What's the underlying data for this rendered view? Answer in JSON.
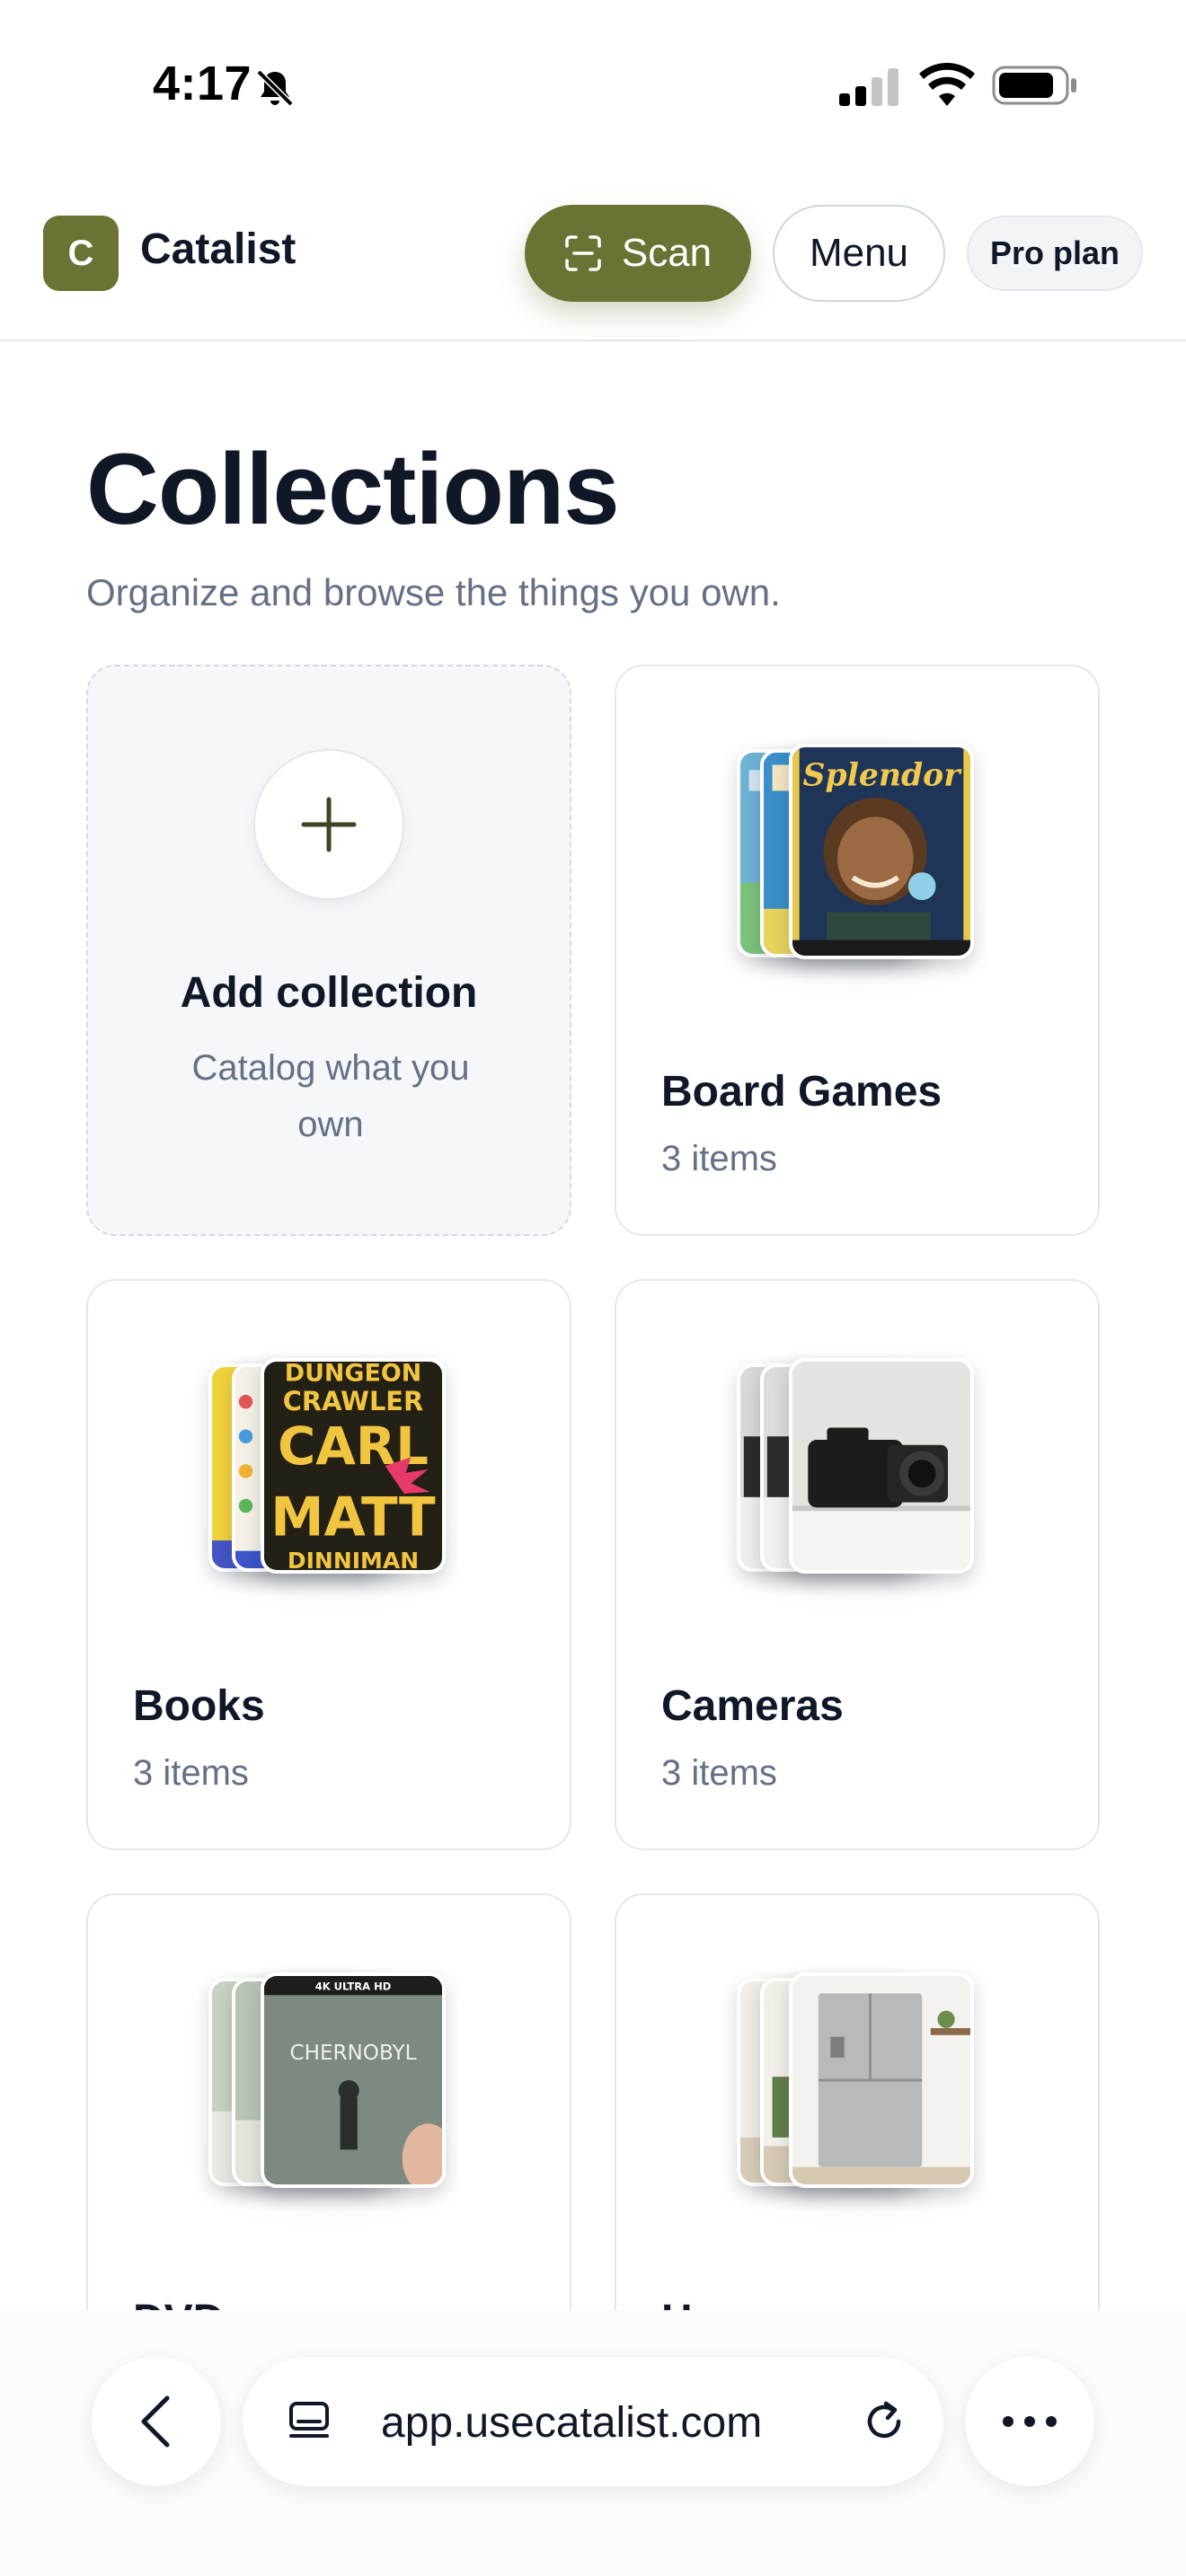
{
  "status_bar": {
    "time": "4:17",
    "icons": [
      "bell-slash-icon",
      "cellular-signal-icon",
      "wifi-icon",
      "battery-icon"
    ]
  },
  "header": {
    "logo_letter": "C",
    "app_name": "Catalist",
    "scan_label": "Scan",
    "menu_label": "Menu",
    "plan_label": "Pro plan"
  },
  "main": {
    "title": "Collections",
    "subtitle": "Organize and browse the things you own.",
    "add_card": {
      "title": "Add collection",
      "subtitle": "Catalog what you own"
    },
    "collections": [
      {
        "name": "Board Games",
        "count": "3 items"
      },
      {
        "name": "Books",
        "count": "3 items"
      },
      {
        "name": "Cameras",
        "count": "3 items"
      },
      {
        "name": "DVDs",
        "count": ""
      },
      {
        "name": "Home",
        "count": ""
      }
    ]
  },
  "cover_text": {
    "splendor": "Splendor",
    "dcc_1": "DUNGEON",
    "dcc_2": "CRAWLER",
    "dcc_3": "CARL",
    "dcc_4": "MATT",
    "dcc_5": "DINNIMAN",
    "chernobyl": "CHERNOBYL",
    "chernobyl_badge": "4K ULTRA HD"
  },
  "browser": {
    "url": "app.usecatalist.com"
  },
  "colors": {
    "brand": "#6b7233",
    "text": "#101828",
    "muted": "#667085",
    "border": "#e4e7ec"
  }
}
